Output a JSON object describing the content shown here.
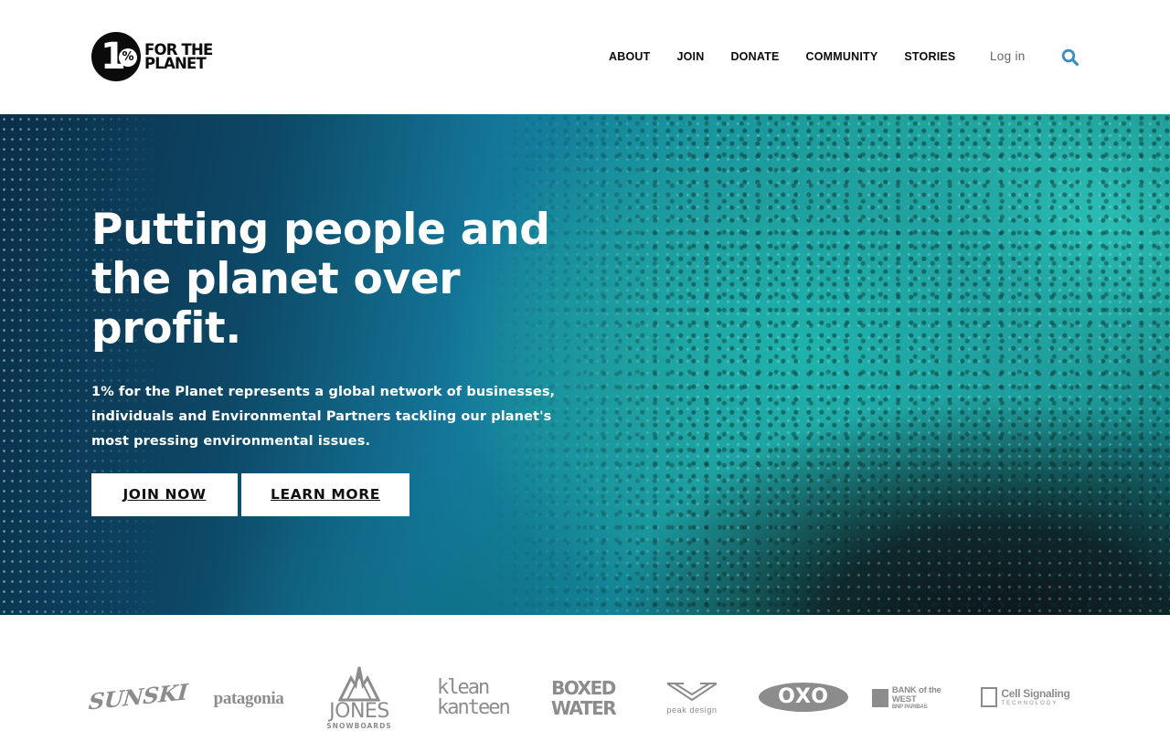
{
  "brand": {
    "logo_one": "1",
    "logo_pct": "%",
    "logo_line1": "FOR THE",
    "logo_line2": "PLANET"
  },
  "nav": {
    "items": [
      "ABOUT",
      "JOIN",
      "DONATE",
      "COMMUNITY",
      "STORIES"
    ],
    "login": "Log in",
    "search_icon": "search-icon"
  },
  "hero": {
    "title": "Putting people and the planet over profit.",
    "subtitle": "1% for the Planet represents a global network of businesses, individuals and Environmental Partners tackling our planet's most pressing environmental issues.",
    "join_label": "JOIN NOW",
    "learn_label": "LEARN MORE"
  },
  "partners": {
    "sunski": "SUNSKI",
    "patagonia": "patagonia",
    "jones_title": "JONES",
    "jones_sub": "SNOWBOARDS",
    "klean_line1": "klean",
    "klean_line2": "kanteen",
    "boxed_line1": "BOXED",
    "boxed_line2": "WATER",
    "peak": "peak design",
    "oxo": "OXO",
    "bank_line1": "BANK of the WEST",
    "bank_line2": "BNP PARIBAS",
    "cell_line1": "Cell Signaling",
    "cell_line2": "TECHNOLOGY"
  },
  "colors": {
    "accent": "#3a8fbf",
    "text_dark": "#0b0b0b",
    "logo_gray": "#8c8c8c"
  }
}
